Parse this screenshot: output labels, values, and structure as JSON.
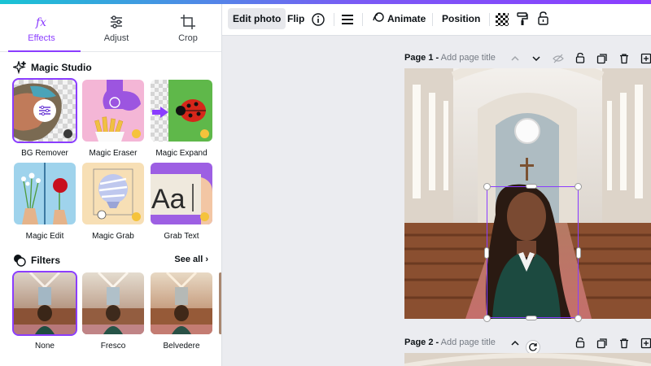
{
  "sidebar": {
    "tabs": [
      {
        "label": "Effects",
        "icon": "fx-icon",
        "active": true
      },
      {
        "label": "Adjust",
        "icon": "sliders-icon",
        "active": false
      },
      {
        "label": "Crop",
        "icon": "crop-icon",
        "active": false
      }
    ],
    "magic_studio": {
      "title": "Magic Studio",
      "tools": [
        {
          "label": "BG Remover"
        },
        {
          "label": "Magic Eraser"
        },
        {
          "label": "Magic Expand"
        },
        {
          "label": "Magic Edit"
        },
        {
          "label": "Magic Grab"
        },
        {
          "label": "Grab Text"
        }
      ]
    },
    "filters": {
      "title": "Filters",
      "see_all": "See all",
      "items": [
        {
          "label": "None",
          "selected": true
        },
        {
          "label": "Fresco",
          "selected": false
        },
        {
          "label": "Belvedere",
          "selected": false
        }
      ]
    }
  },
  "toolbar": {
    "edit_photo": "Edit photo",
    "flip": "Flip",
    "animate": "Animate",
    "position": "Position"
  },
  "pages": [
    {
      "number_label": "Page 1 -",
      "title_placeholder": "Add page title"
    },
    {
      "number_label": "Page 2 -",
      "title_placeholder": "Add page title"
    }
  ],
  "colors": {
    "accent": "#8b3dff",
    "canvas_bg": "#ebecf0",
    "pro_crown": "#f5c33b"
  }
}
